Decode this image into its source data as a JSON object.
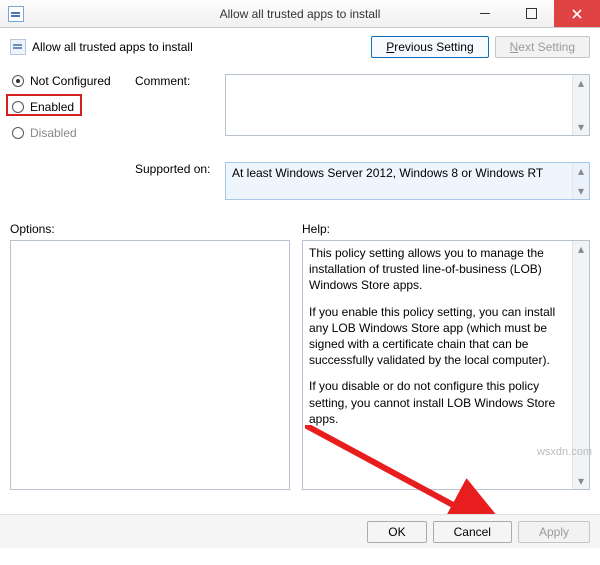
{
  "window": {
    "title": "Allow all trusted apps to install"
  },
  "header": {
    "policy_title": "Allow all trusted apps to install",
    "prev": "Previous Setting",
    "prev_underline_char": "P",
    "next": "Next Setting",
    "next_underline_char": "N"
  },
  "state": {
    "not_configured": "Not Configured",
    "enabled": "Enabled",
    "disabled": "Disabled"
  },
  "labels": {
    "comment": "Comment:",
    "supported_on": "Supported on:",
    "options": "Options:",
    "help": "Help:"
  },
  "fields": {
    "comment_value": "",
    "supported_value": "At least Windows Server 2012, Windows 8 or Windows RT"
  },
  "help": {
    "p1": "This policy setting allows you to manage the installation of trusted line-of-business (LOB) Windows Store apps.",
    "p2": "If you enable this policy setting, you can install any LOB Windows Store app (which must be signed with a certificate chain that can be successfully validated by the local computer).",
    "p3": "If you disable or do not configure this policy setting, you cannot install LOB Windows Store apps."
  },
  "buttons": {
    "ok": "OK",
    "cancel": "Cancel",
    "apply": "Apply"
  },
  "watermark": "wsxdn.com"
}
